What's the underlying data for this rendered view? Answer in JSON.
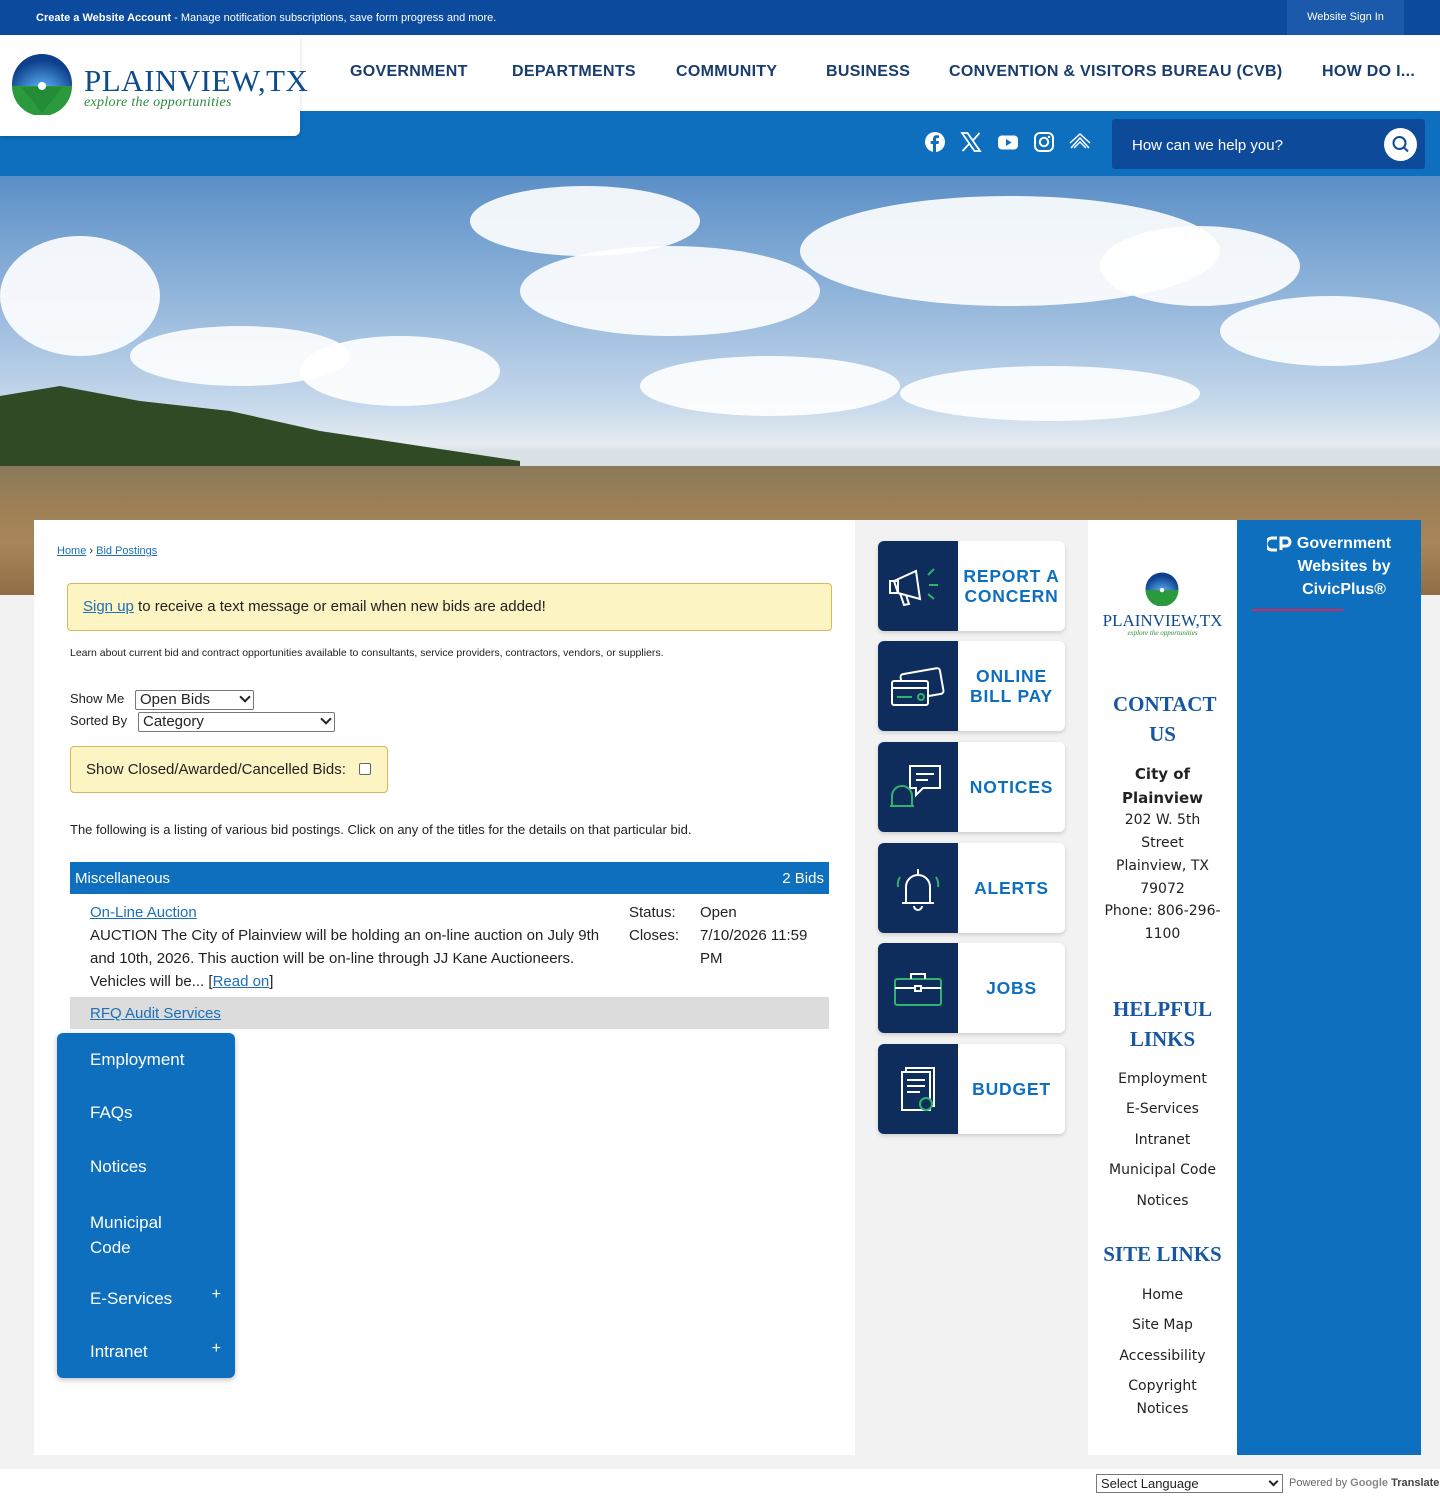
{
  "topbar": {
    "account_link": "Create a Website Account",
    "account_text": " - Manage notification subscriptions, save form progress and more.",
    "sign_in": "Website Sign In"
  },
  "logo": {
    "brand": "PLAINVIEW,TX",
    "tagline": "explore the opportunities"
  },
  "nav": {
    "items": [
      "GOVERNMENT",
      "DEPARTMENTS",
      "COMMUNITY",
      "BUSINESS",
      "CONVENTION & VISITORS BUREAU (CVB)",
      "HOW DO I..."
    ]
  },
  "social": {
    "icons": [
      "facebook-icon",
      "x-twitter-icon",
      "youtube-icon",
      "instagram-icon",
      "alert-feed-icon"
    ]
  },
  "search": {
    "placeholder": "How can we help you?"
  },
  "breadcrumb": {
    "home": "Home",
    "separator": "›",
    "current": "Bid Postings"
  },
  "signup": {
    "link": "Sign up",
    "text": " to receive a text message or email when new bids are added!"
  },
  "intro": "Learn about current bid and contract opportunities available to consultants, service providers, contractors, vendors, or suppliers.",
  "filters": {
    "show_me_label": "Show Me",
    "show_me_value": "Open Bids",
    "sorted_by_label": "Sorted By",
    "sorted_by_value": "Category",
    "closed_label": "Show Closed/Awarded/Cancelled Bids:"
  },
  "listing_text": "The following is a listing of various bid postings. Click on any of the titles for the details on that particular bid.",
  "category": {
    "name": "Miscellaneous",
    "count": "2 Bids"
  },
  "bids": [
    {
      "title": "On-Line Auction",
      "description": "AUCTION The City of Plainview will be holding an on-line auction on July 9th and 10th, 2026. This auction will be on-line through JJ Kane Auctioneers. Vehicles will be... ",
      "read_on": "Read on",
      "status_label": "Status:",
      "status_value": "Open",
      "closes_label": "Closes:",
      "closes_value": "7/10/2026 11:59 PM"
    },
    {
      "title": "RFQ Audit Services"
    }
  ],
  "left_menu": {
    "items": [
      "Employment",
      "FAQs",
      "Notices",
      "Municipal Code",
      "E-Services",
      "Intranet"
    ],
    "expand_symbol": "+"
  },
  "quick_links": [
    {
      "label": "REPORT A CONCERN",
      "icon": "megaphone-icon"
    },
    {
      "label": "ONLINE BILL PAY",
      "icon": "credit-card-icon"
    },
    {
      "label": "NOTICES",
      "icon": "chat-bell-icon"
    },
    {
      "label": "ALERTS",
      "icon": "bell-icon"
    },
    {
      "label": "JOBS",
      "icon": "briefcase-icon"
    },
    {
      "label": "BUDGET",
      "icon": "document-dollar-icon"
    }
  ],
  "contact": {
    "logo_brand": "PLAINVIEW,TX",
    "logo_tagline": "explore the opportunities",
    "heading": "CONTACT US",
    "org": "City of Plainview",
    "address1": "202 W. 5th Street",
    "address2": "Plainview, TX 79072",
    "phone": "Phone: 806-296-1100"
  },
  "helpful_links": {
    "heading": "HELPFUL LINKS",
    "items": [
      "Employment",
      "E-Services",
      "Intranet",
      "Municipal Code",
      "Notices"
    ]
  },
  "site_links": {
    "heading": "SITE LINKS",
    "items": [
      "Home",
      "Site Map",
      "Accessibility",
      "Copyright Notices"
    ]
  },
  "civicplus": {
    "text": "Government Websites by CivicPlus®"
  },
  "footer": {
    "language": "Select Language",
    "powered_by": "Powered by",
    "google": "Google",
    "translate": "Translate"
  },
  "colors": {
    "primary_blue": "#0d6fbe",
    "dark_blue": "#0c4a9e",
    "navy": "#0f2d5c",
    "notice_yellow": "#fdf4c4",
    "accent_red": "#d5285a",
    "brand_green": "#2b8a3e"
  }
}
